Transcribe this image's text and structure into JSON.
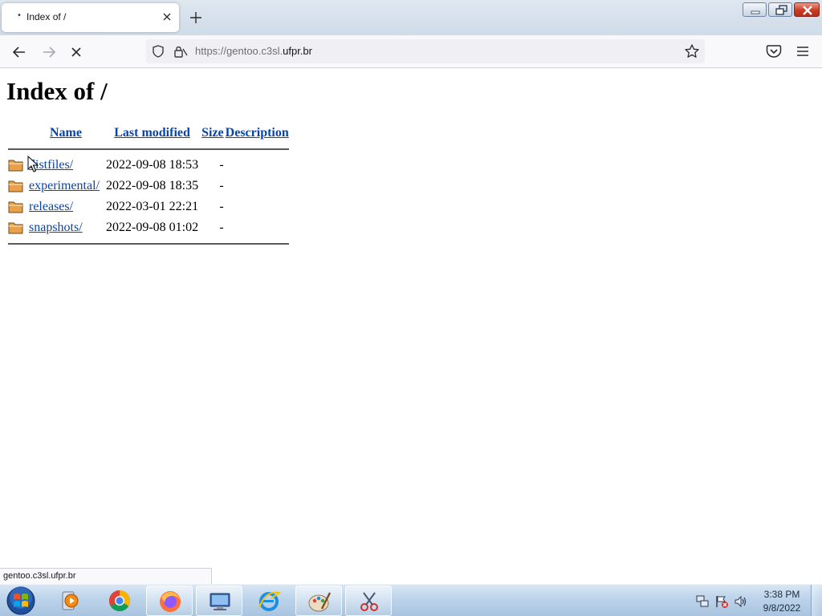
{
  "browser": {
    "tab": {
      "title": "Index of /"
    },
    "address_bar": {
      "url_prefix": "https://gentoo.c3sl.",
      "url_domain": "ufpr.br"
    },
    "status_text": "gentoo.c3sl.ufpr.br"
  },
  "page": {
    "title": "Index of /",
    "columns": {
      "name": "Name",
      "modified": "Last modified",
      "size": "Size",
      "description": "Description"
    },
    "entries": [
      {
        "name": "distfiles/",
        "modified": "2022-09-08 18:53",
        "size": "-",
        "icon": "folder-icon"
      },
      {
        "name": "experimental/",
        "modified": "2022-09-08 18:35",
        "size": "-",
        "icon": "folder-icon"
      },
      {
        "name": "releases/",
        "modified": "2022-03-01 22:21",
        "size": "-",
        "icon": "folder-icon"
      },
      {
        "name": "snapshots/",
        "modified": "2022-09-08 01:02",
        "size": "-",
        "icon": "folder-icon"
      }
    ]
  },
  "taskbar": {
    "apps": [
      "windows-media-player-icon",
      "chrome-icon",
      "firefox-icon",
      "computer-icon",
      "internet-explorer-icon",
      "paint-icon",
      "snipping-tool-icon"
    ],
    "clock": {
      "time": "3:38 PM",
      "date": "9/8/2022"
    }
  },
  "colors": {
    "link": "#0645ad",
    "taskbar": "#bcd3ea",
    "close_button": "#cc3b23"
  }
}
